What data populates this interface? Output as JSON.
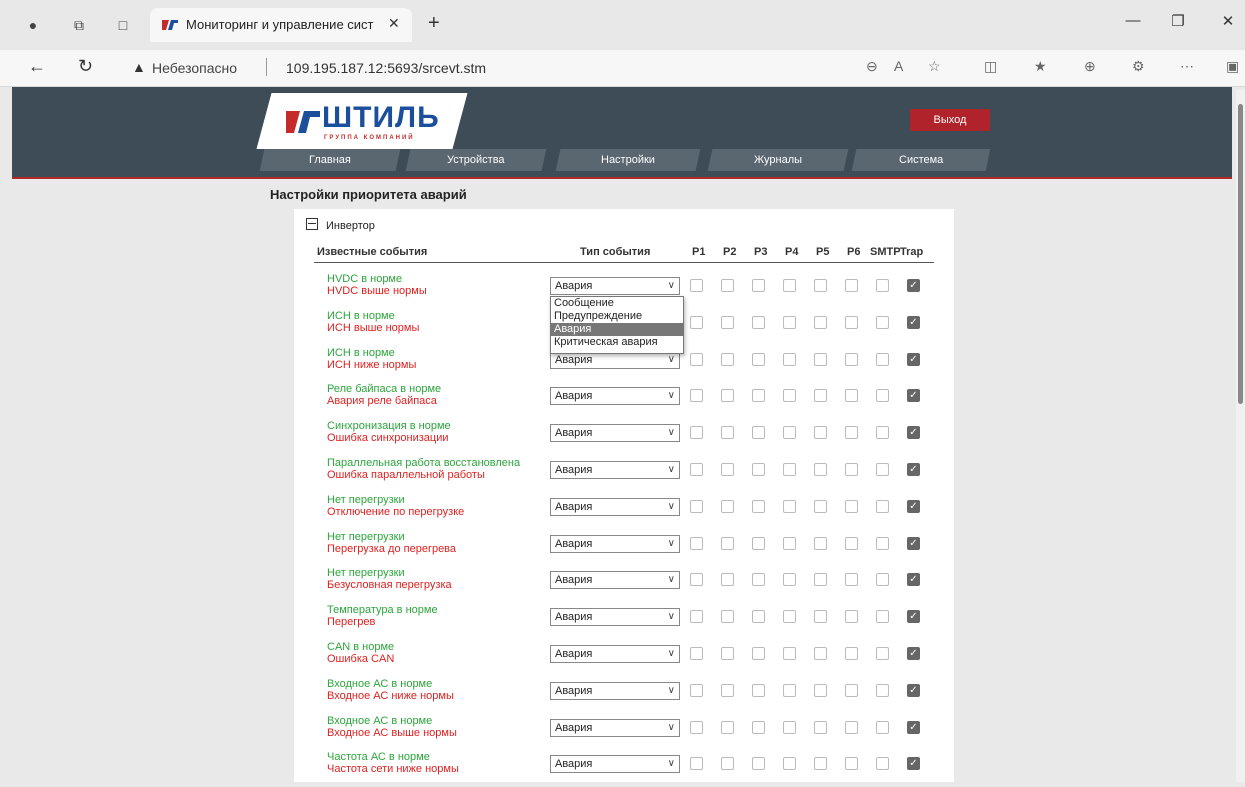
{
  "browser": {
    "tab_title": "Мониторинг и управление сист",
    "address_insecure": "Небезопасно",
    "url": "109.195.187.12:5693/srcevt.stm"
  },
  "header": {
    "logo_text": "ШТИЛЬ",
    "logo_sub": "ГРУППА КОМПАНИЙ",
    "exit_label": "Выход",
    "menu": [
      "Главная",
      "Устройства",
      "Настройки",
      "Журналы",
      "Система"
    ]
  },
  "page": {
    "title": "Настройки приоритета аварий",
    "group": "Инвертор",
    "columns": {
      "events": "Известные события",
      "type": "Тип события",
      "p1": "P1",
      "p2": "P2",
      "p3": "P3",
      "p4": "P4",
      "p5": "P5",
      "p6": "P6",
      "smtp": "SMTP",
      "trap": "Trap"
    },
    "rows": [
      {
        "ok": "HVDC в норме",
        "bad": "HVDC выше нормы",
        "type": "Авария",
        "trap": true
      },
      {
        "ok": "ИСН в норме",
        "bad": "ИСН выше нормы",
        "type": "Авария",
        "trap": true
      },
      {
        "ok": "ИСН в норме",
        "bad": "ИСН ниже нормы",
        "type": "Авария",
        "trap": true
      },
      {
        "ok": "Реле байпаса в норме",
        "bad": "Авария реле байпаса",
        "type": "Авария",
        "trap": true
      },
      {
        "ok": "Синхронизация в норме",
        "bad": "Ошибка синхронизации",
        "type": "Авария",
        "trap": true
      },
      {
        "ok": "Параллельная работа восстановлена",
        "bad": "Ошибка параллельной работы",
        "type": "Авария",
        "trap": true
      },
      {
        "ok": "Нет перегрузки",
        "bad": "Отключение по перегрузке",
        "type": "Авария",
        "trap": true
      },
      {
        "ok": "Нет перегрузки",
        "bad": "Перегрузка до перегрева",
        "type": "Авария",
        "trap": true
      },
      {
        "ok": "Нет перегрузки",
        "bad": "Безусловная перегрузка",
        "type": "Авария",
        "trap": true
      },
      {
        "ok": "Температура в норме",
        "bad": "Перегрев",
        "type": "Авария",
        "trap": true
      },
      {
        "ok": "CAN в норме",
        "bad": "Ошибка CAN",
        "type": "Авария",
        "trap": true
      },
      {
        "ok": "Входное АС в норме",
        "bad": "Входное АС ниже нормы",
        "type": "Авария",
        "trap": true
      },
      {
        "ok": "Входное АС в норме",
        "bad": "Входное АС выше нормы",
        "type": "Авария",
        "trap": true
      },
      {
        "ok": "Частота АС в норме",
        "bad": "Частота сети ниже нормы",
        "type": "Авария",
        "trap": true
      }
    ],
    "dropdown_options": [
      "Сообщение",
      "Предупреждение",
      "Авария",
      "Критическая авария"
    ],
    "dropdown_highlight": "Авария"
  }
}
